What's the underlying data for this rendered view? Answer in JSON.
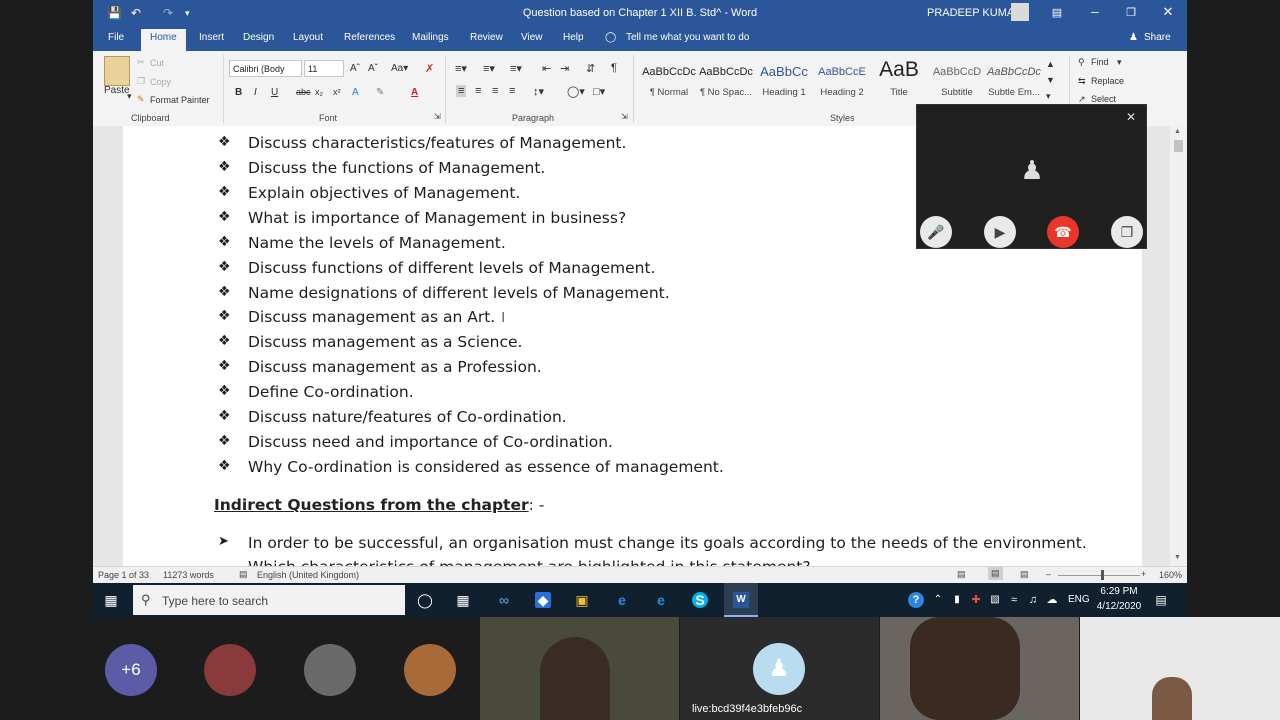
{
  "window": {
    "title": "Question based on Chapter 1 XII B. Std^ - Word",
    "user": "PRADEEP KUMAR",
    "qa_icons": [
      "save-icon",
      "undo-icon",
      "redo-icon",
      "customize-icon"
    ]
  },
  "tabs": [
    "File",
    "Home",
    "Insert",
    "Design",
    "Layout",
    "References",
    "Mailings",
    "Review",
    "View",
    "Help"
  ],
  "tell_me": "Tell me what you want to do",
  "share_label": "Share",
  "ribbon": {
    "clipboard": {
      "paste": "Paste",
      "cut": "Cut",
      "copy": "Copy",
      "format_painter": "Format Painter",
      "label": "Clipboard"
    },
    "font": {
      "name": "Calibri (Body",
      "size": "11",
      "label": "Font",
      "buttons": [
        "B",
        "I",
        "U",
        "abc",
        "x₂",
        "x²"
      ]
    },
    "paragraph": {
      "label": "Paragraph"
    },
    "styles": {
      "label": "Styles",
      "items": [
        {
          "sample": "AaBbCcDc",
          "name": "¶ Normal"
        },
        {
          "sample": "AaBbCcDc",
          "name": "¶ No Spac..."
        },
        {
          "sample": "AaBbCc",
          "name": "Heading 1"
        },
        {
          "sample": "AaBbCcE",
          "name": "Heading 2"
        },
        {
          "sample": "AaB",
          "name": "Title"
        },
        {
          "sample": "AaBbCcD",
          "name": "Subtitle"
        },
        {
          "sample": "AaBbCcDc",
          "name": "Subtle Em..."
        }
      ]
    },
    "editing": {
      "find": "Find",
      "replace": "Replace",
      "select": "Select"
    }
  },
  "document": {
    "bullets": [
      "Discuss characteristics/features of Management.",
      "Discuss the functions of Management.",
      "Explain objectives of Management.",
      "What is importance of Management in business?",
      "Name the levels of Management.",
      "Discuss functions of different levels of Management.",
      "Name designations of different levels of Management.",
      "Discuss management as an Art.",
      "Discuss management as a Science.",
      "Discuss management as a Profession.",
      "Define Co-ordination.",
      "Discuss nature/features of Co-ordination.",
      "Discuss need and importance of Co-ordination.",
      "Why Co-ordination is considered as essence of management."
    ],
    "heading": "Indirect Questions from the chapter",
    "heading_suffix": ": -",
    "arrow_item": "In order to be successful, an organisation must change its goals according to the needs of the environment.",
    "partial_line": "Which characteristics of management are highlighted in this statement?"
  },
  "status": {
    "page": "Page 1 of 33",
    "words": "11273 words",
    "language": "English (United Kingdom)",
    "zoom": "160%"
  },
  "taskbar": {
    "search_placeholder": "Type here to search",
    "language": "ENG",
    "time": "6:29 PM",
    "date": "4/12/2020"
  },
  "meeting": {
    "more_count": "+6",
    "live_label": "live:bcd39f4e3bfeb96c"
  }
}
